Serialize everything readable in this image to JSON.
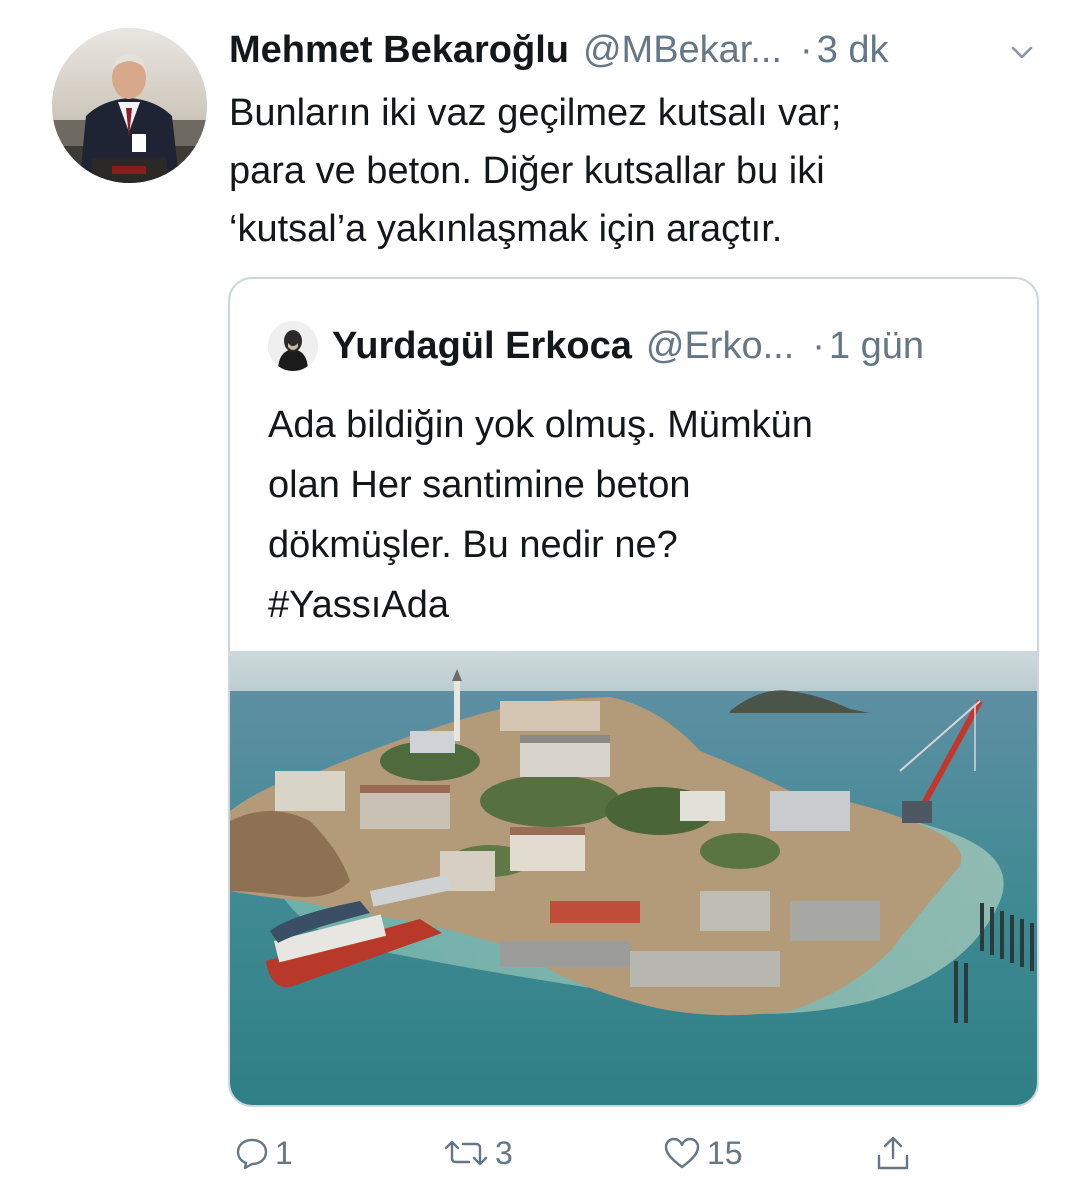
{
  "tweet": {
    "author": {
      "name": "Mehmet Bekaroğlu",
      "handle": "@MBekar...",
      "dot": "·",
      "time": "3 dk"
    },
    "text_lines": [
      "Bunların iki vaz geçilmez kutsalı var;",
      "para ve beton. Diğer kutsallar bu iki",
      "‘kutsal’a yakınlaşmak için araçtır."
    ],
    "quote": {
      "author": {
        "name": "Yurdagül Erkoca",
        "handle": "@Erko...",
        "dot": "·",
        "time": "1 gün"
      },
      "text_lines": [
        "Ada bildiğin yok olmuş. Mümkün",
        "olan Her santimine beton",
        "dökmüşler. Bu nedir ne?",
        "#YassıAda"
      ]
    },
    "actions": {
      "reply_count": "1",
      "retweet_count": "3",
      "like_count": "15"
    }
  },
  "colors": {
    "text": "#14171a",
    "secondary": "#657786",
    "border": "#ccd6dd",
    "sea": "#3f8a93"
  },
  "icons": [
    "chevron-down-icon",
    "reply-icon",
    "retweet-icon",
    "like-icon",
    "share-icon"
  ]
}
